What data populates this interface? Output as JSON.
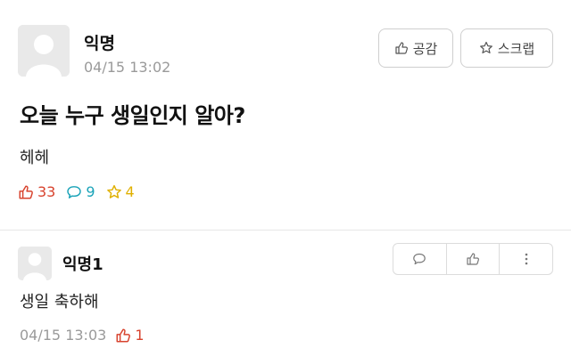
{
  "post": {
    "author": "익명",
    "time": "04/15 13:02",
    "buttons": {
      "like_label": "공감",
      "scrap_label": "스크랩"
    },
    "title": "오늘 누구 생일인지 알아?",
    "body": "헤헤",
    "stats": {
      "likes": "33",
      "comments": "9",
      "scraps": "4"
    }
  },
  "comment": {
    "author": "익명1",
    "text": "생일 축하해",
    "time": "04/15 13:03",
    "likes": "1"
  },
  "colors": {
    "like": "#d8432e",
    "comment": "#1aa3b8",
    "scrap": "#e0b000",
    "muted": "#9a9a9a"
  }
}
